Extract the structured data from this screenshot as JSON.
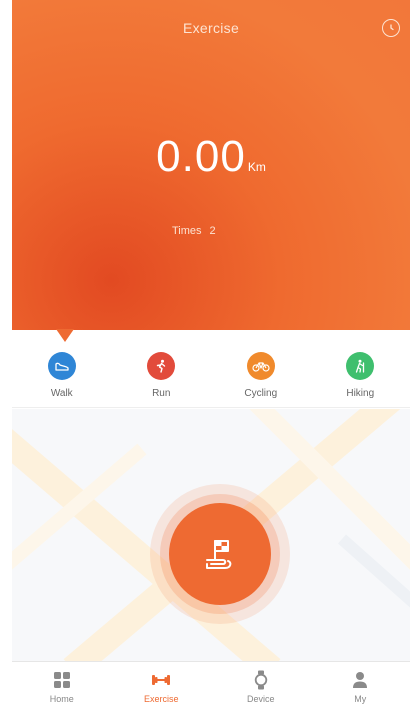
{
  "header": {
    "title": "Exercise",
    "history_icon": "clock-icon"
  },
  "summary": {
    "distance": "0.00",
    "unit": "Km",
    "times_label": "Times",
    "times_value": "2"
  },
  "modes": [
    {
      "label": "Walk",
      "icon": "shoe-icon",
      "color": "#2f86d6",
      "selected": true
    },
    {
      "label": "Run",
      "icon": "running-person-icon",
      "color": "#e24b3b",
      "selected": false
    },
    {
      "label": "Cycling",
      "icon": "bicycle-icon",
      "color": "#f08a2c",
      "selected": false
    },
    {
      "label": "Hiking",
      "icon": "hiking-person-icon",
      "color": "#3fbf6e",
      "selected": false
    }
  ],
  "start_button": {
    "icon": "flag-hand-icon"
  },
  "tabbar": [
    {
      "label": "Home",
      "icon": "grid-icon",
      "active": false
    },
    {
      "label": "Exercise",
      "icon": "dumbbell-icon",
      "active": true
    },
    {
      "label": "Device",
      "icon": "watch-icon",
      "active": false
    },
    {
      "label": "My",
      "icon": "person-icon",
      "active": false
    }
  ],
  "colors": {
    "accent": "#ee6a32",
    "hero_dark": "#e24a22",
    "inactive": "#888888"
  }
}
